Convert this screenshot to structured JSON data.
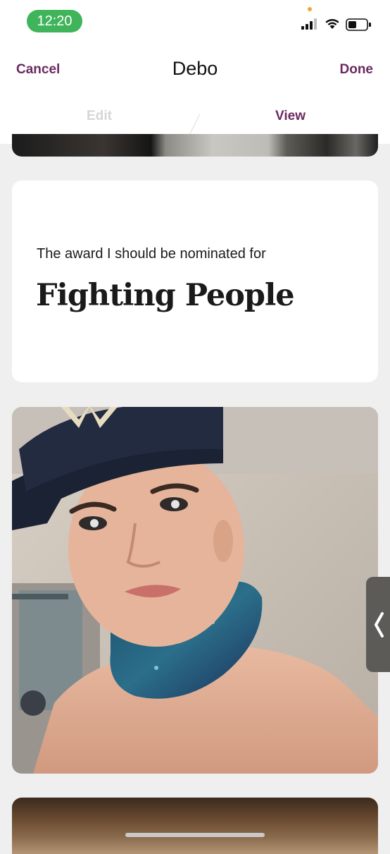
{
  "status_bar": {
    "time": "12:20",
    "icons": [
      "signal-icon",
      "wifi-icon",
      "battery-icon"
    ]
  },
  "nav": {
    "cancel_label": "Cancel",
    "title": "Debo",
    "done_label": "Done"
  },
  "tabs": [
    {
      "label": "Edit",
      "active": false
    },
    {
      "label": "View",
      "active": true
    }
  ],
  "profile": {
    "prompt": {
      "question": "The award I should be nominated for",
      "answer": "Fighting People"
    },
    "photos": [
      "profile-photo-partial-top",
      "profile-photo-selfie",
      "profile-photo-partial-bottom"
    ]
  },
  "colors": {
    "accent": "#6b2a5f",
    "status_pill": "#3fb45a",
    "background": "#efefef",
    "card": "#ffffff",
    "tab_inactive": "#d6d6d6"
  }
}
